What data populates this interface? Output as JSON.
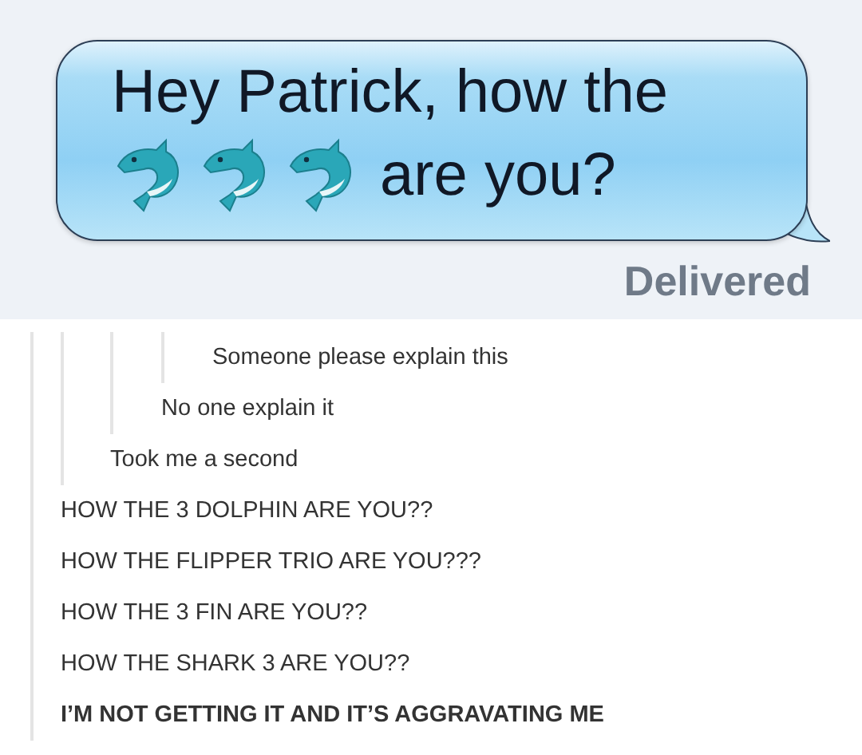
{
  "message": {
    "line_1": "Hey Patrick, how the",
    "line_2": "are you?",
    "status": "Delivered"
  },
  "thread": {
    "quote": {
      "quote": {
        "quote": {
          "comments": [
            {
              "text": "Someone please explain this",
              "bold": false
            }
          ]
        },
        "comments": [
          {
            "text": "No one explain it",
            "bold": false
          }
        ]
      },
      "comments": [
        {
          "text": "Took me a second",
          "bold": false
        }
      ]
    },
    "comments": [
      {
        "text": "HOW THE 3 DOLPHIN ARE YOU??",
        "bold": false
      },
      {
        "text": "HOW THE FLIPPER TRIO ARE YOU???",
        "bold": false
      },
      {
        "text": "HOW THE 3 FIN ARE YOU??",
        "bold": false
      },
      {
        "text": "HOW THE SHARK 3 ARE YOU??",
        "bold": false
      },
      {
        "text": "I’M NOT GETTING IT AND IT’S AGGRAVATING ME",
        "bold": true
      }
    ]
  }
}
